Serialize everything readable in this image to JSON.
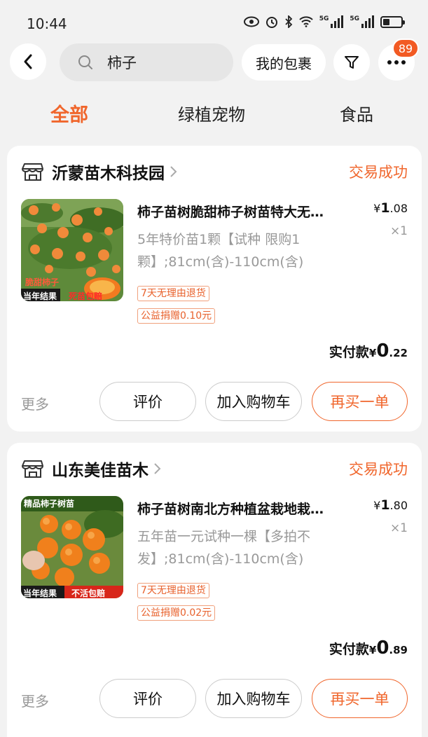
{
  "status_bar": {
    "time": "10:44"
  },
  "search": {
    "query": "柿子"
  },
  "header": {
    "parcel_label": "我的包裹",
    "notification_count": "89"
  },
  "tabs": [
    {
      "label": "全部",
      "active": true
    },
    {
      "label": "绿植宠物",
      "active": false
    },
    {
      "label": "食品",
      "active": false
    }
  ],
  "orders": [
    {
      "shop": "沂蒙苗木科技园",
      "status": "交易成功",
      "title": "柿子苗树脆甜柿子树苗特大无…",
      "sku": "5年特价苗1颗【试种 限购1颗】;81cm(含)-110cm(含)",
      "tags": [
        "7天无理由退货",
        "公益捐赠0.10元"
      ],
      "price_symbol": "¥",
      "price_int": "1",
      "price_dec": ".08",
      "qty": "×1",
      "paid_label": "实付款",
      "paid_symbol": "¥",
      "paid_int": "0",
      "paid_dec": ".22",
      "thumb_text_top": "脆甜柿子",
      "thumb_text_left": "当年结果",
      "thumb_text_right": "死苗包赔",
      "more": "更多",
      "btn_review": "评价",
      "btn_cart": "加入购物车",
      "btn_rebuy": "再买一单"
    },
    {
      "shop": "山东美佳苗木",
      "status": "交易成功",
      "title": "柿子苗树南北方种植盆栽地栽…",
      "sku": "五年苗一元试种一棵【多拍不发】;81cm(含)-110cm(含)",
      "tags": [
        "7天无理由退货",
        "公益捐赠0.02元"
      ],
      "price_symbol": "¥",
      "price_int": "1",
      "price_dec": ".80",
      "qty": "×1",
      "paid_label": "实付款",
      "paid_symbol": "¥",
      "paid_int": "0",
      "paid_dec": ".89",
      "thumb_text_top": "精品柿子树苗",
      "thumb_text_left": "当年结果",
      "thumb_text_right": "不活包赔",
      "more": "更多",
      "btn_review": "评价",
      "btn_cart": "加入购物车",
      "btn_rebuy": "再买一单"
    }
  ],
  "colors": {
    "accent": "#f0662c",
    "badge": "#f25a23",
    "muted": "#999999"
  }
}
